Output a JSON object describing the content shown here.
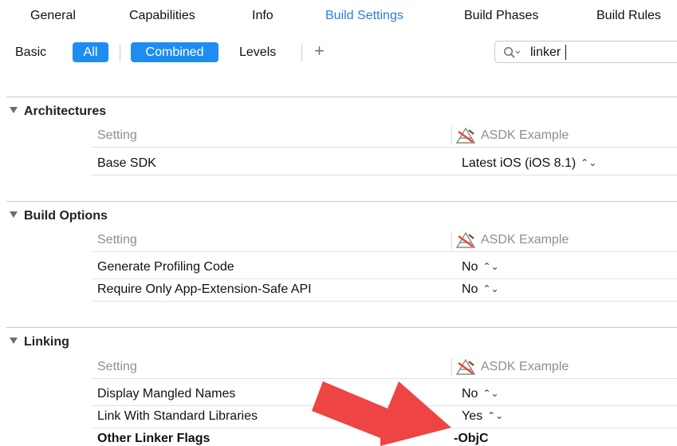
{
  "tabs": [
    {
      "label": "General"
    },
    {
      "label": "Capabilities"
    },
    {
      "label": "Info"
    },
    {
      "label": "Build Settings"
    },
    {
      "label": "Build Phases"
    },
    {
      "label": "Build Rules"
    }
  ],
  "active_tab": "Build Settings",
  "filter_bar": {
    "basic": "Basic",
    "all": "All",
    "combined": "Combined",
    "levels": "Levels",
    "add_symbol": "+"
  },
  "search": {
    "value": "linker"
  },
  "sections": [
    {
      "title": "Architectures",
      "column_setting": "Setting",
      "column_target": "ASDK Example",
      "rows": [
        {
          "name": "Base SDK",
          "value": "Latest iOS (iOS 8.1)",
          "stepper": "⌃⌄"
        }
      ]
    },
    {
      "title": "Build Options",
      "column_setting": "Setting",
      "column_target": "ASDK Example",
      "rows": [
        {
          "name": "Generate Profiling Code",
          "value": "No",
          "stepper": "⌃⌄"
        },
        {
          "name": "Require Only App-Extension-Safe API",
          "value": "No",
          "stepper": "⌃⌄"
        }
      ]
    },
    {
      "title": "Linking",
      "column_setting": "Setting",
      "column_target": "ASDK Example",
      "rows": [
        {
          "name": "Display Mangled Names",
          "value": "No",
          "stepper": "⌃⌄"
        },
        {
          "name": "Link With Standard Libraries",
          "value": "Yes",
          "stepper": "⌃⌄"
        },
        {
          "name": "Other Linker Flags",
          "value": "-ObjC",
          "stepper": ""
        }
      ]
    }
  ],
  "colors": {
    "accent": "#1e8cf0",
    "active_tab_text": "#2b7cdf",
    "annotation_arrow": "#ef4444"
  },
  "icons": {
    "search": "magnifier-with-dropdown-icon",
    "target": "xcode-app-target-icon",
    "disclosure": "disclosure-triangle-icon",
    "annotation": "red-arrow-icon"
  }
}
